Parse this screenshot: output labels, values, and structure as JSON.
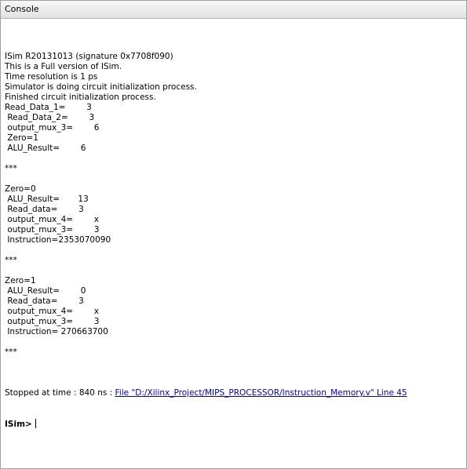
{
  "panel": {
    "title": "Console"
  },
  "console": {
    "lines": [
      "ISim R20131013 (signature 0x7708f090)",
      "This is a Full version of ISim.",
      "Time resolution is 1 ps",
      "Simulator is doing circuit initialization process.",
      "Finished circuit initialization process.",
      "Read_Data_1=        3",
      " Read_Data_2=        3",
      " output_mux_3=        6",
      " Zero=1",
      " ALU_Result=        6",
      "",
      "***",
      "",
      "Zero=0",
      " ALU_Result=       13",
      " Read_data=        3",
      " output_mux_4=        x",
      " output_mux_3=        3",
      " Instruction=2353070090",
      "",
      "***",
      "",
      "Zero=1",
      " ALU_Result=        0",
      " Read_data=        3",
      " output_mux_4=        x",
      " output_mux_3=        3",
      " Instruction= 270663700",
      "",
      "***",
      ""
    ],
    "stopped_prefix": "Stopped at time : 840 ns : ",
    "stopped_link": "File \"D:/Xilinx_Project/MIPS_PROCESSOR/Instruction_Memory.v\" Line 45",
    "prompt": "ISim>"
  }
}
